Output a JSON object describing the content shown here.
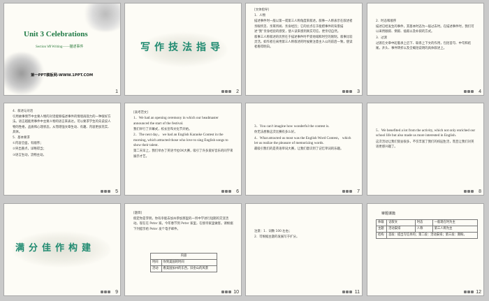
{
  "slides": [
    {
      "num": "1",
      "title": "Unit 3  Celebrations",
      "subtitle": "Section Ⅶ  Writing——描述事件",
      "footer": "第一PPT模板网-WWW.1PPT.COM"
    },
    {
      "num": "2",
      "title": "写作技法指导"
    },
    {
      "num": "3",
      "lines": [
        "[文体指导]",
        "1．人物",
        "描述事件时一般以第一或第三人称角度来叙述。叙事一人称表示在叙述者亲眼所见、亲耳所闻、亲身经历；它的优点在于能把事件的背景描述“我”亲身经验的感受，使人读来感到真实可信，更亲切自然。",
        "叙事三人称叙述的优势在于描述事件时不受地域和时空的限制，叙事比较灵活。如作者在采用第三人称叙述的时候要注意主人公的前后一致，使读者看得明白。"
      ]
    },
    {
      "num": "4",
      "lines": [
        "2．时态和顺序",
        "描述已经发生的事件，其基本时态为一般过去时。在描述事件时，我们可以采用顺叙、倒叙、插叙以及补叙的方式。",
        "3．过渡",
        "过渡在文章中起着承上启下、联系上下文的作用，包括首句、中句和结尾，开头、事件转折以及全概括说明的具体叙述上。"
      ]
    },
    {
      "num": "5",
      "lines": [
        "4．叙述与对话",
        "引用故事情节中主要人物的对话能够描述事件的情境再现力的一种很好方法。语言越能用事件中主要人物的语言来表达。可以要求学生的先说说人物的性格，品质和心理状态，从而增强文章生动、有趣、内容更加充实、具体。",
        "5．基本要求",
        "①内容全面，有顺序；",
        "②突出重点，详略得当；",
        "③语言生动，流畅主动。"
      ]
    },
    {
      "num": "6",
      "lines": [
        "[高考范文]",
        "1．We had an opening ceremony in which our headmaster announced the start of the festival.",
        "我们举行了开幕式，校长宣布文化节开始。",
        "2．The next day， we had an English Karaoke Contest in the morning, which attracted those who love to sing English songs to show their talent.",
        "第二天早上，我们举办了英语卡拉OK大赛，吸引了许多爱好音乐的同学来展示才艺。"
      ]
    },
    {
      "num": "7",
      "lines": [
        "3．You can't imagine how wonderful the contest is.",
        "你无法想象这次比赛有多么好。",
        "4．What attracted us most was the English Word Contest， which let us realize the pleasure of memorizing words.",
        "最吸引我们的是英语单词大赛，让我们意识到了记忆单词的乐趣。"
      ]
    },
    {
      "num": "8",
      "lines": [
        "5．We benefited a lot from the activity, which not only enriched our school life but also made us more interested in English.",
        "这次活动让我们受益很多，不仅丰富了我们的校园生活，而且让我们对英语更感兴趣了。"
      ]
    },
    {
      "num": "9",
      "title": "满分佳作构建"
    },
    {
      "num": "10",
      "lines": [
        "[题目]",
        "假定你是李明，你有幸能去加州参加那里的一所中学进行短期的交流活动。现在在 Peter 家。今年春节到 Peter 家里，在接待家里做客。请根据下列提示给 Peter 发个电子邮件。"
      ],
      "table": {
        "header": "内容",
        "rows": [
          [
            "时间",
            "你到美国的时间"
          ],
          [
            "活动",
            "看美国加州的东西，旧金山的风景"
          ]
        ]
      }
    },
    {
      "num": "11",
      "lines": [
        "注意：1．词数 100 左右；",
        "2．可根据主题的发展写于扩分。"
      ]
    },
    {
      "num": "12",
      "label": "审题谋篇",
      "table": {
        "rows": [
          [
            "体裁",
            "记叙文",
            "时态",
            "一般现在时为主"
          ],
          [
            "主题",
            "活动安排",
            "人称",
            "第三人称为主"
          ],
          [
            "结构",
            "首段：提出写信目的；第二段：活动安排；第三段：期盼。",
            "",
            ""
          ]
        ]
      }
    }
  ]
}
